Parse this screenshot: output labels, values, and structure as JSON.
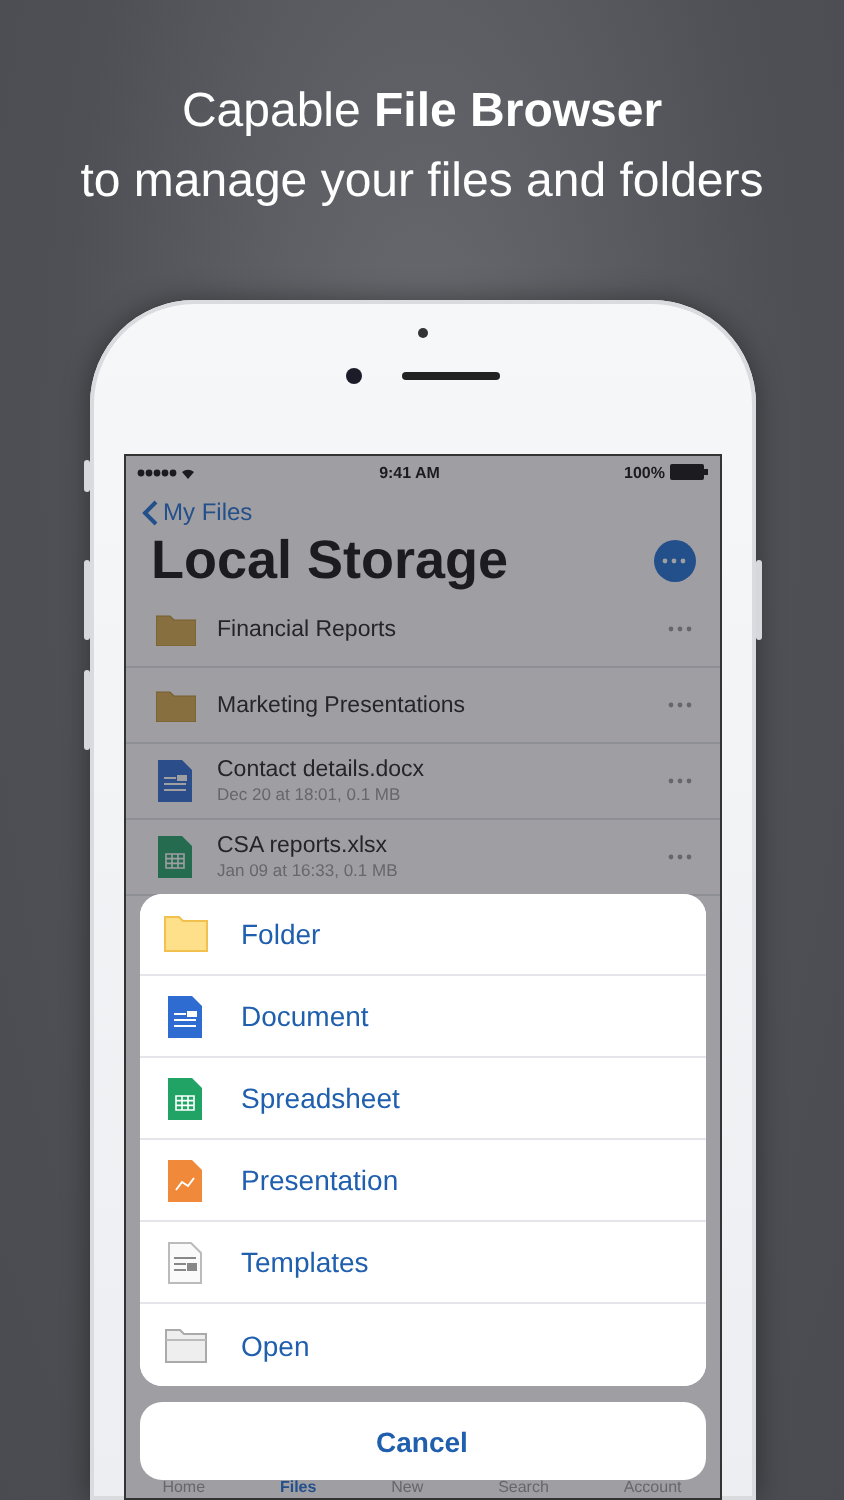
{
  "headline": {
    "line_1": "Capable **File Browser**",
    "line_2": "to manage your files and folders"
  },
  "status_bar": {
    "time": "9:41 AM",
    "battery": "100%"
  },
  "nav": {
    "back": "My Files",
    "title": "Local Storage"
  },
  "files": [
    {
      "kind": "folder",
      "name": "Financial Reports"
    },
    {
      "kind": "folder",
      "name": "Marketing Presentations"
    },
    {
      "kind": "document",
      "name": "Contact details.docx",
      "detail": "Dec 20 at 18:01, 0.1 MB"
    },
    {
      "kind": "spreadsheet",
      "name": "CSA reports.xlsx",
      "detail": "Jan 09 at 16:33, 0.1 MB"
    }
  ],
  "tab_bar": [
    {
      "label": "Home",
      "selected": false
    },
    {
      "label": "Files",
      "selected": true
    },
    {
      "label": "New",
      "selected": false
    },
    {
      "label": "Search",
      "selected": false
    },
    {
      "label": "Account",
      "selected": false
    }
  ],
  "action_sheet": {
    "actions": [
      {
        "kind": "folder",
        "label": "Folder"
      },
      {
        "kind": "document",
        "label": "Document"
      },
      {
        "kind": "spreadsheet",
        "label": "Spreadsheet"
      },
      {
        "kind": "presentation",
        "label": "Presentation"
      },
      {
        "kind": "template",
        "label": "Templates"
      },
      {
        "kind": "open",
        "label": "Open"
      }
    ],
    "cancel": "Cancel"
  }
}
